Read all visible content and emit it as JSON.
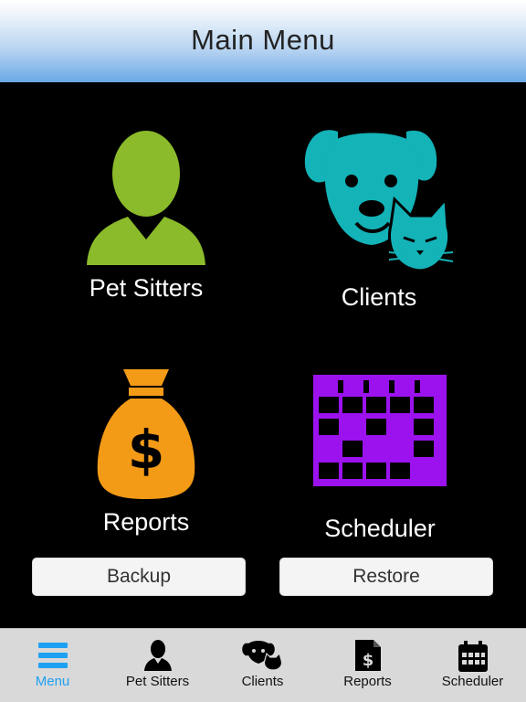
{
  "header": {
    "title": "Main Menu"
  },
  "tiles": [
    {
      "label": "Pet Sitters",
      "icon": "person-icon",
      "color": "#8bbb2b"
    },
    {
      "label": "Clients",
      "icon": "dog-cat-icon",
      "color": "#13b3b8"
    },
    {
      "label": "Reports",
      "icon": "money-bag-icon",
      "color": "#f39a17"
    },
    {
      "label": "Scheduler",
      "icon": "calendar-grid-icon",
      "color": "#9b12ef"
    }
  ],
  "buttons": {
    "backup": "Backup",
    "restore": "Restore"
  },
  "tabbar": {
    "active": "Menu",
    "active_color": "#1ea1f2",
    "items": [
      {
        "label": "Menu",
        "icon": "hamburger-icon"
      },
      {
        "label": "Pet Sitters",
        "icon": "person-icon"
      },
      {
        "label": "Clients",
        "icon": "dog-cat-icon"
      },
      {
        "label": "Reports",
        "icon": "report-dollar-icon"
      },
      {
        "label": "Scheduler",
        "icon": "calendar-icon"
      }
    ]
  }
}
